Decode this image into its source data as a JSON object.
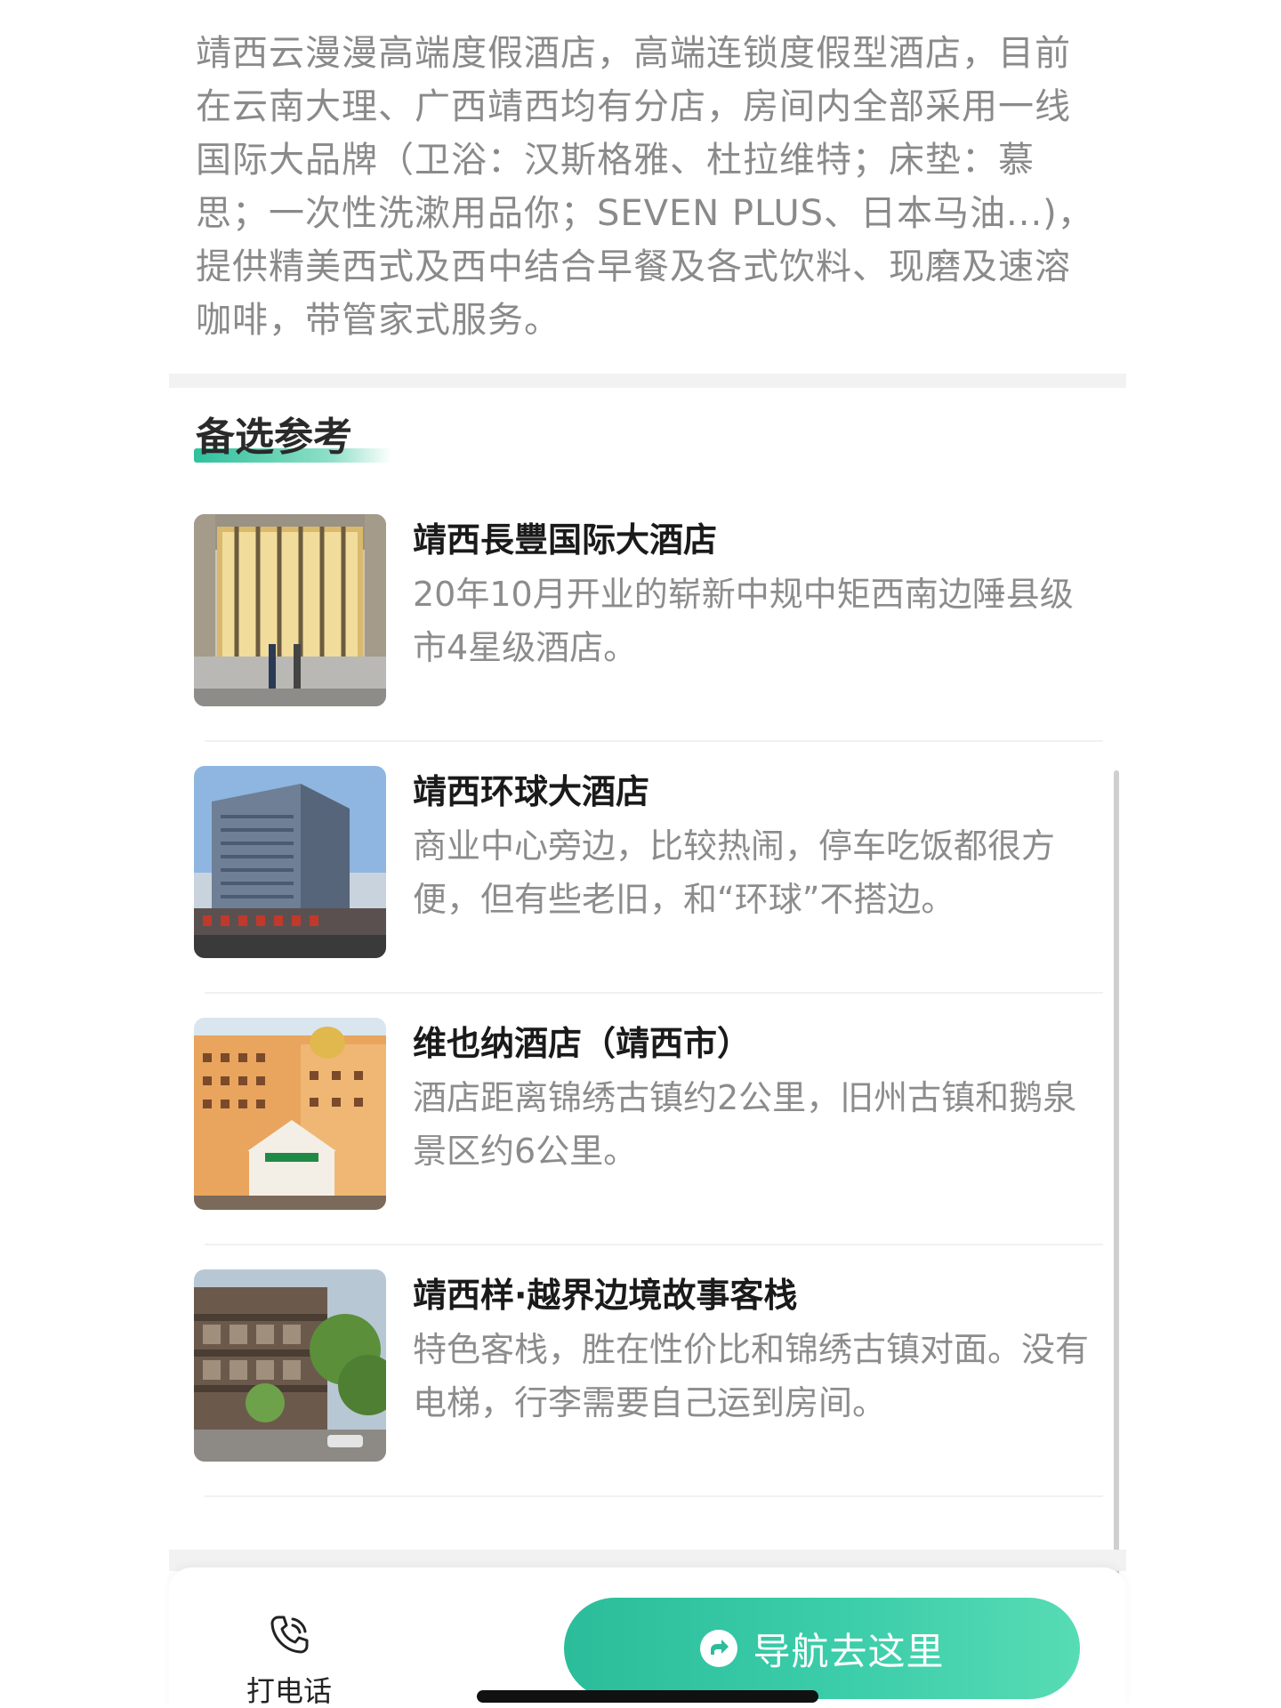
{
  "intro": {
    "text": "靖西云漫漫高端度假酒店，高端连锁度假型酒店，目前在云南大理、广西靖西均有分店，房间内全部采用一线国际大品牌（卫浴：汉斯格雅、杜拉维特；床垫：慕思；一次性洗漱用品你；SEVEN PLUS、日本马油...)，提供精美西式及西中结合早餐及各式饮料、现磨及速溶咖啡，带管家式服务。"
  },
  "section": {
    "title": "备选参考"
  },
  "hotels": [
    {
      "name": "靖西長豐国际大酒店",
      "desc": "20年10月开业的崭新中规中矩西南边陲县级市4星级酒店。",
      "image": "hotel-lobby-photo"
    },
    {
      "name": "靖西环球大酒店",
      "desc": "商业中心旁边，比较热闹，停车吃饭都很方便，但有些老旧，和“环球”不搭边。",
      "image": "hotel-tower-photo"
    },
    {
      "name": "维也纳酒店（靖西市）",
      "desc": "酒店距离锦绣古镇约2公里，旧州古镇和鹅泉景区约6公里。",
      "image": "hotel-facade-photo"
    },
    {
      "name": "靖西样·越界边境故事客栈",
      "desc": "特色客栈，胜在性价比和锦绣古镇对面。没有电梯，行李需要自己运到房间。",
      "image": "inn-courtyard-photo"
    }
  ],
  "bottom_bar": {
    "call_label": "打电话",
    "call_icon": "phone-icon",
    "nav_label": "导航去这里",
    "nav_icon": "navigate-arrow-icon",
    "accent": "#2fc19c"
  }
}
